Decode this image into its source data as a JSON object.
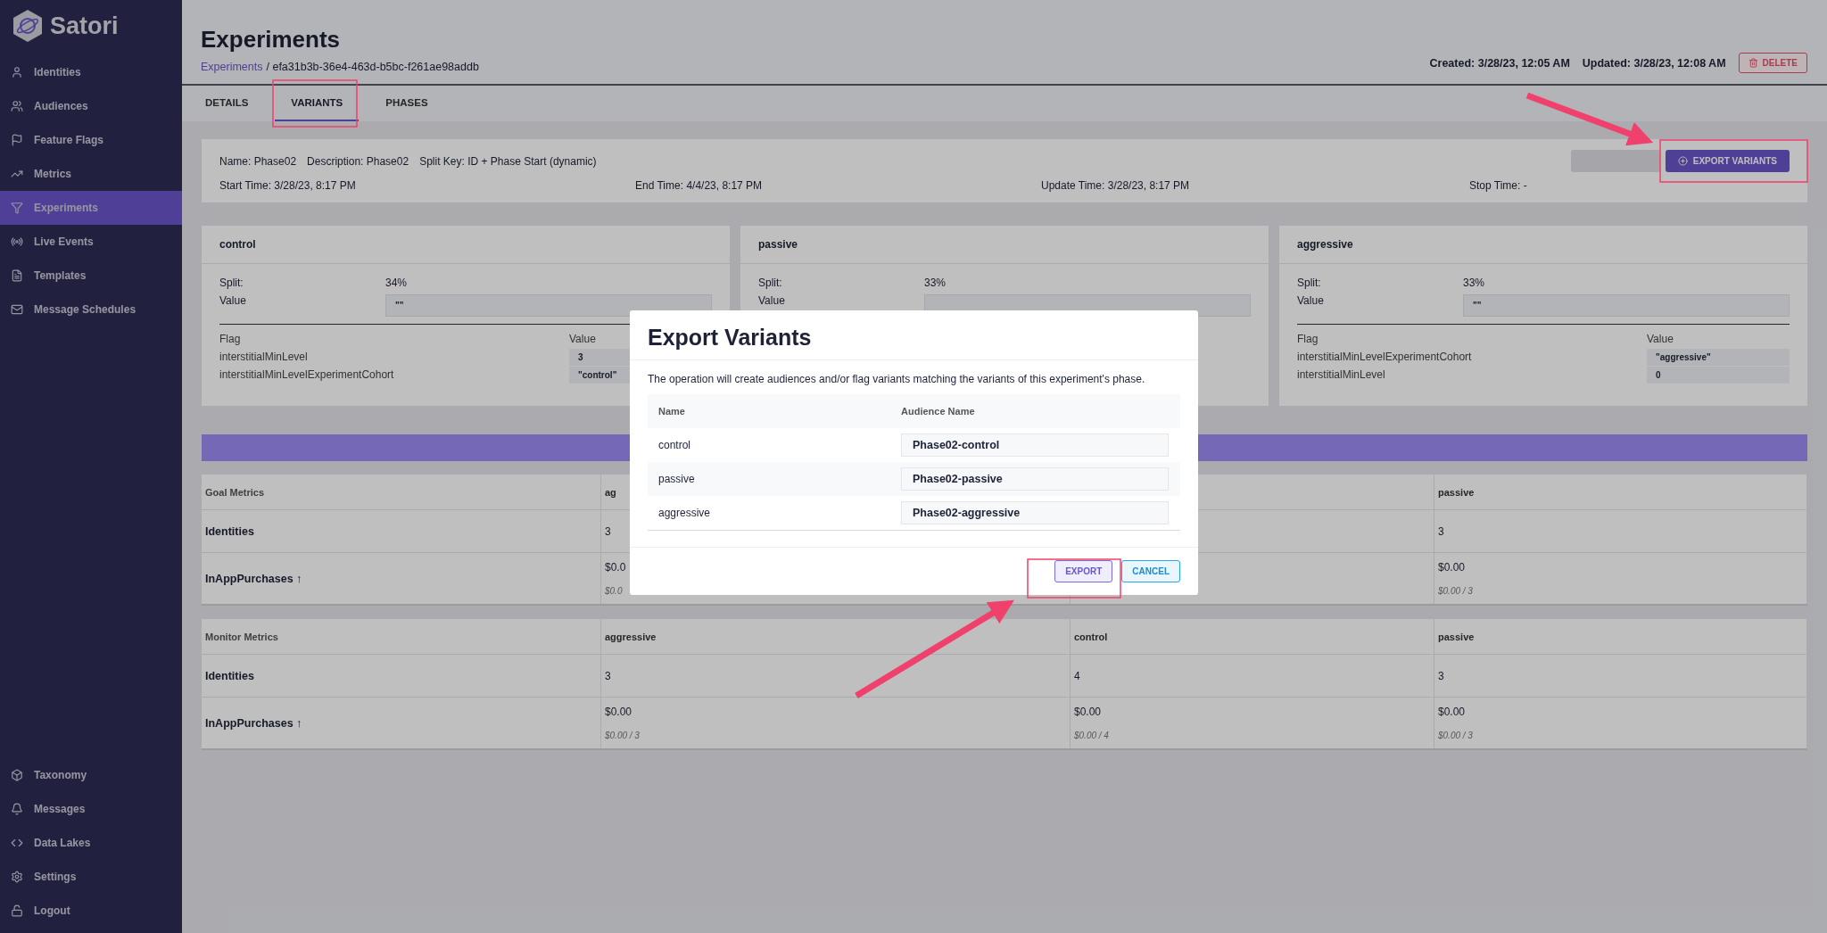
{
  "sidebar": {
    "logo": "Satori",
    "items": [
      {
        "label": "Identities",
        "selected": false
      },
      {
        "label": "Audiences",
        "selected": false
      },
      {
        "label": "Feature Flags",
        "selected": false
      },
      {
        "label": "Metrics",
        "selected": false
      },
      {
        "label": "Experiments",
        "selected": true
      },
      {
        "label": "Live Events",
        "selected": false
      },
      {
        "label": "Templates",
        "selected": false
      },
      {
        "label": "Message Schedules",
        "selected": false
      }
    ],
    "bottom_items": [
      {
        "label": "Taxonomy"
      },
      {
        "label": "Messages"
      },
      {
        "label": "Data Lakes"
      },
      {
        "label": "Settings"
      },
      {
        "label": "Logout"
      }
    ]
  },
  "header": {
    "title": "Experiments",
    "breadcrumb_link": "Experiments",
    "breadcrumb_rest": "/ efa31b3b-36e4-463d-b5bc-f261ae98addb",
    "created_label": "Created:",
    "created": "3/28/23, 12:05 AM",
    "updated_label": "Updated:",
    "updated": "3/28/23, 12:08 AM",
    "delete": "DELETE"
  },
  "tabs": [
    {
      "label": "DETAILS",
      "selected": false
    },
    {
      "label": "VARIANTS",
      "selected": true
    },
    {
      "label": "PHASES",
      "selected": false
    }
  ],
  "phase": {
    "top": [
      {
        "label": "Name:",
        "value": "Phase02"
      },
      {
        "label": "Description:",
        "value": "Phase02"
      },
      {
        "label": "Split Key:",
        "value": "ID + Phase Start (dynamic)"
      }
    ],
    "times": [
      {
        "label": "Start Time:",
        "value": "3/28/23, 8:17 PM"
      },
      {
        "label": "End Time:",
        "value": "4/4/23, 8:17 PM"
      },
      {
        "label": "Update Time:",
        "value": "3/28/23, 8:17 PM"
      },
      {
        "label": "Stop Time:",
        "value": "-"
      }
    ],
    "export_button": "EXPORT VARIANTS"
  },
  "variants": [
    {
      "name": "control",
      "split_label": "Split:",
      "split": "34%",
      "value_label": "Value",
      "value": "\"\"",
      "flag_header": "Flag",
      "value_header": "Value",
      "flags": [
        {
          "flag": "interstitialMinLevel",
          "value": "3"
        },
        {
          "flag": "interstitialMinLevelExperimentCohort",
          "value": "\"control\""
        }
      ]
    },
    {
      "name": "passive",
      "split_label": "Split:",
      "split": "33%",
      "value_label": "Value"
    },
    {
      "name": "aggressive",
      "split_label": "Split:",
      "split": "33%",
      "value_label": "Value",
      "value": "\"\"",
      "flag_header": "Flag",
      "value_header": "Value",
      "flags": [
        {
          "flag": "interstitialMinLevelExperimentCohort",
          "value": "\"aggressive\""
        },
        {
          "flag": "interstitialMinLevel",
          "value": "0"
        }
      ]
    }
  ],
  "goal_metrics": {
    "columns": [
      "Goal Metrics",
      "ag",
      "",
      "passive"
    ],
    "rows": [
      {
        "cells": [
          {
            "value": "Identities"
          },
          {
            "value": "3"
          },
          {},
          {
            "value": "3"
          }
        ]
      },
      {
        "cells": [
          {
            "value": "InAppPurchases ↑"
          },
          {
            "value": "$0.0",
            "sub": "$0.0"
          },
          {},
          {
            "value": "$0.00",
            "sub": "$0.00 / 3"
          }
        ]
      }
    ]
  },
  "monitor_metrics": {
    "columns": [
      "Monitor Metrics",
      "aggressive",
      "control",
      "passive"
    ],
    "rows": [
      {
        "cells": [
          {
            "value": "Identities"
          },
          {
            "value": "3"
          },
          {
            "value": "4"
          },
          {
            "value": "3"
          }
        ]
      },
      {
        "cells": [
          {
            "value": "InAppPurchases ↑"
          },
          {
            "value": "$0.00",
            "sub": "$0.00 / 3"
          },
          {
            "value": "$0.00",
            "sub": "$0.00 / 4"
          },
          {
            "value": "$0.00",
            "sub": "$0.00 / 3"
          }
        ]
      }
    ]
  },
  "modal": {
    "title": "Export Variants",
    "description": "The operation will create audiences and/or flag variants matching the variants of this experiment's phase.",
    "columns": [
      "Name",
      "Audience Name"
    ],
    "rows": [
      {
        "name": "control",
        "audience": "Phase02-control"
      },
      {
        "name": "passive",
        "audience": "Phase02-passive"
      },
      {
        "name": "aggressive",
        "audience": "Phase02-aggressive"
      }
    ],
    "buttons": [
      "EXPORT",
      "CANCEL"
    ]
  }
}
